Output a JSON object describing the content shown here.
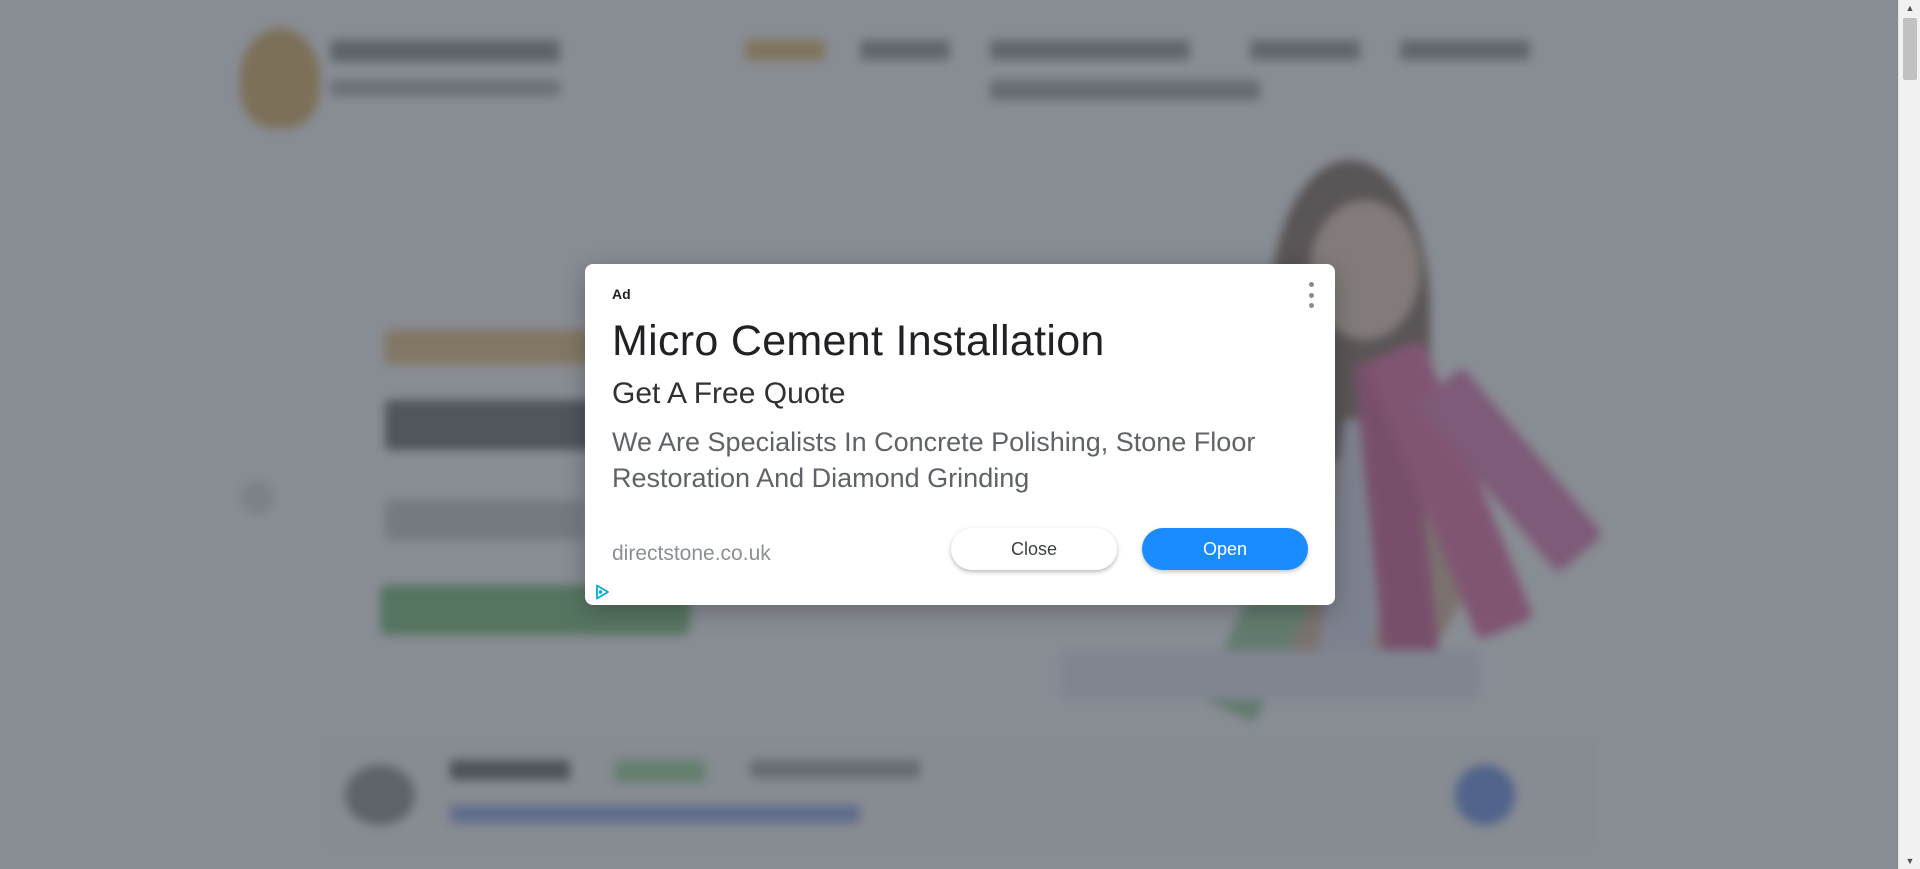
{
  "ad": {
    "label": "Ad",
    "headline": "Micro Cement Installation",
    "subheadline": "Get A Free Quote",
    "description": "We Are Specialists In Concrete Polishing, Stone Floor Restoration And Diamond Grinding",
    "display_url": "directstone.co.uk",
    "close_label": "Close",
    "open_label": "Open",
    "menu_icon": "more-vertical-icon",
    "adchoices_icon": "adchoices-icon"
  },
  "colors": {
    "open_button": "#1a8cff",
    "overlay": "#5a5f69"
  }
}
